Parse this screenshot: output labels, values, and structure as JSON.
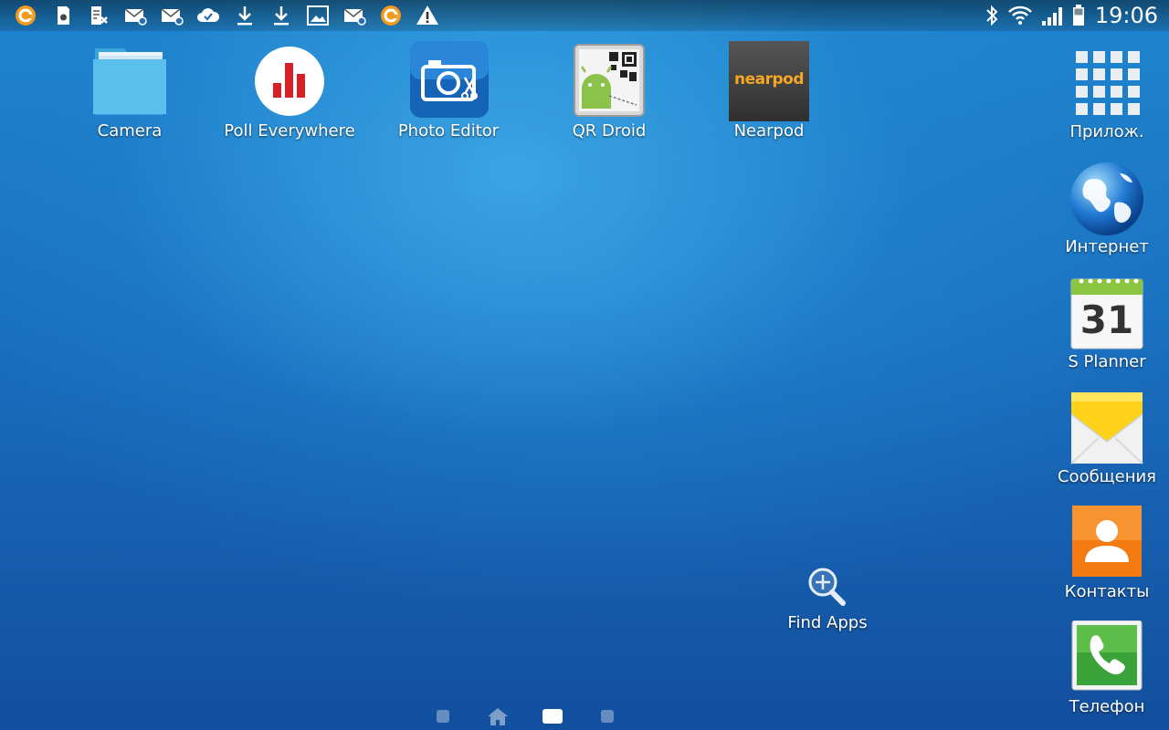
{
  "status_bar": {
    "clock": "19:06"
  },
  "shortcuts": [
    {
      "id": "camera",
      "label": "Camera"
    },
    {
      "id": "poll-everywhere",
      "label": "Poll Everywhere"
    },
    {
      "id": "photo-editor",
      "label": "Photo Editor"
    },
    {
      "id": "qr-droid",
      "label": "QR Droid"
    },
    {
      "id": "nearpod",
      "label": "Nearpod",
      "logo_text": "nearpod"
    }
  ],
  "find_apps": {
    "label": "Find Apps"
  },
  "dock": [
    {
      "id": "apps",
      "label": "Прилож."
    },
    {
      "id": "internet",
      "label": "Интернет"
    },
    {
      "id": "s-planner",
      "label": "S Planner",
      "date": "31"
    },
    {
      "id": "messages",
      "label": "Сообщения"
    },
    {
      "id": "contacts",
      "label": "Контакты"
    },
    {
      "id": "phone",
      "label": "Телефон"
    }
  ],
  "pager": {
    "current": 3,
    "total": 4
  },
  "colors": {
    "poll_red": "#d71f26",
    "nearpod_orange": "#f6a623",
    "contacts_orange": "#f47a12",
    "phone_green": "#3aa33a",
    "planner_green": "#8bc53f"
  }
}
